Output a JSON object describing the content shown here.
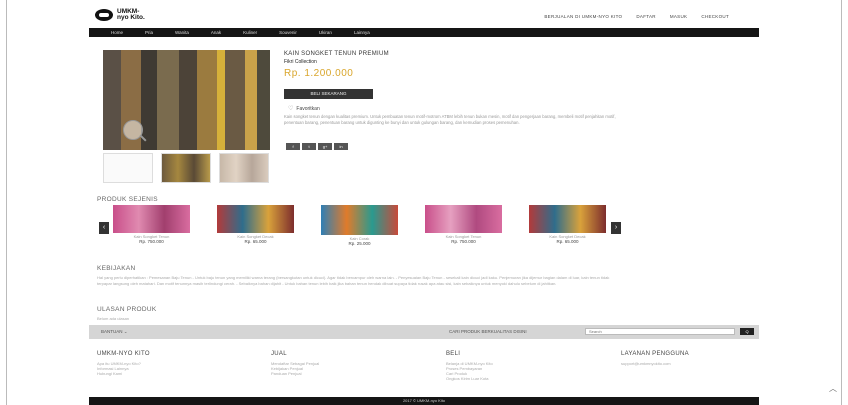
{
  "brand": {
    "name": "UMKM-nyo Kito."
  },
  "top_links": [
    "BERJUALAN DI UMKM-NYO KITO",
    "DAFTAR",
    "MASUK",
    "CHECKOUT"
  ],
  "nav": [
    "Home",
    "Pria",
    "Wanita",
    "Anak",
    "Kuliner",
    "Souvenir",
    "Ukiran",
    "Lainnya"
  ],
  "product": {
    "title": "KAIN SONGKET TENUN PREMIUM",
    "shop": "Fikri Collection",
    "price": "Rp. 1.200.000",
    "buy_label": "BELI SEKARANG",
    "favorite_label": "Favoritkan",
    "description": "Kain songket tenun dengan kualitas premium. Untuk pembuatan tenun motif-motrom ATBM lebih tenun bukan mesin, motif dan pengerjaan barang, membeli motif penjahitan motif, penentuan barang, penentuan barang untuk digunting ke bunyi dan untuk gulungan barang, dan kemudian proses pemenuhan.",
    "share": [
      "f",
      "t",
      "g+",
      "in"
    ]
  },
  "sections": {
    "similar_title": "PRODUK SEJENIS",
    "policy_title": "KEBIJAKAN",
    "policy_text": "Hal yang perlu diperhatikan : Pemesanan Baju Tenun - Untuk baju tenun yang memiliki warna terang (bersangkutan untuk dicuci). Agar tidak bercampur oleh warna lain. - Penyesuaian Baju Tenun - sesekali kain dicuci jadi kaku. Penjemuran jika dijemur bagian dalam di luar, kain tenun tidak terpapar langsung oleh matahari. Dan motif tenunnya masih terlindungi cerah. - Sebaiknya bahan dijahit - Untuk bahan tenun lebih baik jika bahan tenun hendak dibuat supaya tidak rusak apa atau sisi, kain sebaiknya untuk menyoki dahulu sebelum di jahitkan.",
    "reviews_title": "ULASAN PRODUK",
    "reviews_empty": "Belum ada ulasan"
  },
  "similar_products": [
    {
      "name": "Kain Songket Tenun",
      "price": "Rp. 750.000"
    },
    {
      "name": "Kain Songket Decak",
      "price": "Rp. 65.000"
    },
    {
      "name": "Kain Corak",
      "price": "Rp. 25.000"
    },
    {
      "name": "Kain Songket Tenun",
      "price": "Rp. 750.000"
    },
    {
      "name": "Kain Songket Decak",
      "price": "Rp. 65.000"
    }
  ],
  "bar": {
    "help": "BANTUAN",
    "search_label": "CARI PRODUK BERKUALITAS DISINI",
    "search_placeholder": "Search",
    "search_button": "Q"
  },
  "footer": [
    {
      "head": "UMKM-NYO KITO",
      "links": [
        "Apa itu UMKM-nyo Kito?",
        "Informasi Lainnya",
        "Hubungi Kami"
      ]
    },
    {
      "head": "JUAL",
      "links": [
        "Mendaftar Sebagai Penjual",
        "Kebijakan Penjual",
        "Panduan Penjual"
      ]
    },
    {
      "head": "BELI",
      "links": [
        "Belanja di UMKM-nyo Kito",
        "Proses Pembayaran",
        "Cari Produk",
        "Ongkos Kirim Luar Kota"
      ]
    },
    {
      "head": "LAYANAN PENGGUNA",
      "links": [
        "support@umkmnyokito.com"
      ]
    }
  ],
  "copyright": "2017 © UMKM-nyo Kito",
  "colors": {
    "price": "#d9a62c",
    "nav_bg": "#151515",
    "bar_bg": "#d5d5d5"
  }
}
